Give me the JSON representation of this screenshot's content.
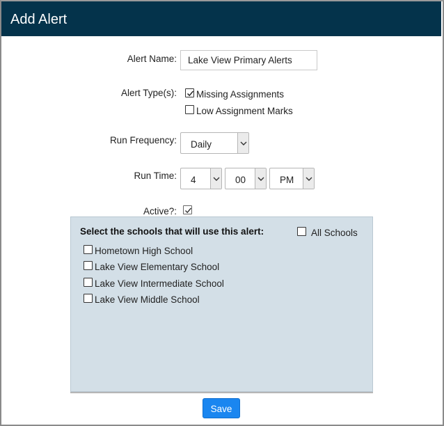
{
  "dialog": {
    "title": "Add Alert"
  },
  "form": {
    "alert_name": {
      "label": "Alert Name:",
      "value": "Lake View Primary Alerts"
    },
    "alert_types": {
      "label": "Alert Type(s):",
      "options": [
        {
          "label": "Missing Assignments",
          "checked": true
        },
        {
          "label": "Low Assignment Marks",
          "checked": false
        }
      ]
    },
    "run_frequency": {
      "label": "Run Frequency:",
      "value": "Daily"
    },
    "run_time": {
      "label": "Run Time:",
      "hour": "4",
      "minute": "00",
      "ampm": "PM"
    },
    "active": {
      "label": "Active?:",
      "checked": true
    }
  },
  "schools_panel": {
    "title": "Select the schools that will use this alert:",
    "all_schools": {
      "label": "All Schools",
      "checked": false
    },
    "schools": [
      {
        "label": "Hometown High School",
        "checked": false
      },
      {
        "label": "Lake View Elementary School",
        "checked": false
      },
      {
        "label": "Lake View Intermediate School",
        "checked": false
      },
      {
        "label": "Lake View Middle School",
        "checked": false
      }
    ]
  },
  "actions": {
    "save_label": "Save"
  },
  "colors": {
    "header_bg": "#04334b",
    "panel_bg": "#d3dfe7",
    "save_button": "#1a86f0"
  }
}
